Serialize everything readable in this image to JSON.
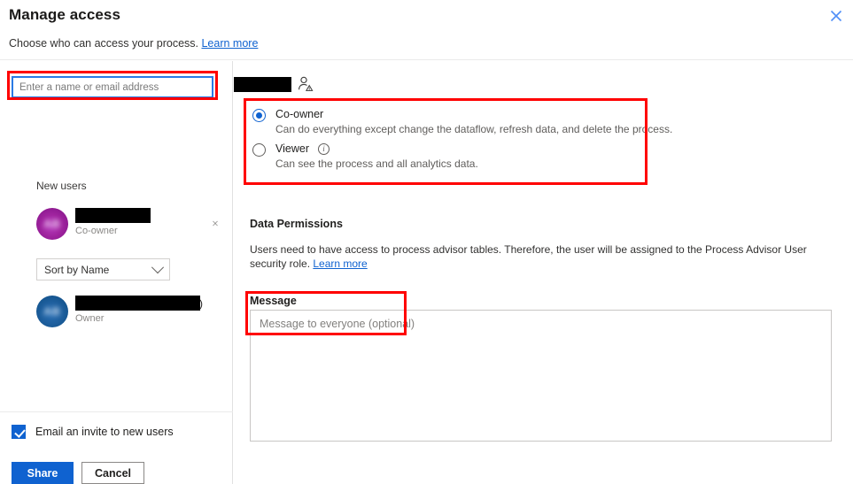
{
  "header": {
    "title": "Manage access",
    "subtitle_text": "Choose who can access your process.",
    "subtitle_link": "Learn more",
    "close_icon": "close-icon",
    "close_color": "#4f8ef7"
  },
  "left_panel": {
    "search": {
      "placeholder": "Enter a name or email address",
      "value": "",
      "focus_border_color": "#2a7ae4"
    },
    "new_users_label": "New users",
    "users": [
      {
        "name": "",
        "name_redacted": true,
        "role": "Co-owner",
        "avatar_initials": "AB",
        "avatar_color": "#a0249f",
        "removable": true,
        "remove_icon": "close-icon"
      },
      {
        "name": "",
        "name_redacted": true,
        "name_suffix": ")",
        "role": "Owner",
        "avatar_initials": "AB",
        "avatar_color": "#1e5f9e",
        "removable": false
      }
    ],
    "sort": {
      "label": "Sort by Name",
      "chevron_icon": "chevron-down-icon"
    },
    "email_invite": {
      "label": "Email an invite to new users",
      "checked": true,
      "accent": "#0f62d0"
    },
    "buttons": {
      "share": "Share",
      "cancel": "Cancel",
      "primary_color": "#0f62d0"
    }
  },
  "right_panel": {
    "target": {
      "name_redacted": true,
      "icon": "person-warning-icon"
    },
    "roles": [
      {
        "title": "Co-owner",
        "description": "Can do everything except change the dataflow, refresh data, and delete the process.",
        "selected": true,
        "has_info_icon": false
      },
      {
        "title": "Viewer",
        "description": "Can see the process and all analytics data.",
        "selected": false,
        "has_info_icon": true,
        "info_icon": "info-icon"
      }
    ],
    "data_permissions": {
      "title": "Data Permissions",
      "body": "Users need to have access to process advisor tables. Therefore, the user will be assigned to the Process Advisor User security role. ",
      "link": "Learn more"
    },
    "message": {
      "label": "Message",
      "placeholder": "Message to everyone (optional)",
      "value": ""
    }
  },
  "highlights": {
    "color": "#ff0000",
    "boxes": [
      "search-input",
      "role-options",
      "message-field"
    ]
  }
}
